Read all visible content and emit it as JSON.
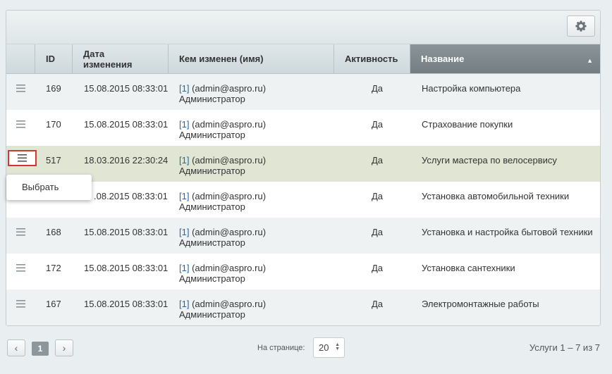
{
  "header": {
    "col_id": "ID",
    "col_date_1": "Дата",
    "col_date_2": "изменения",
    "col_modified": "Кем изменен (имя)",
    "col_active": "Активность",
    "col_name": "Название",
    "sort_arrow": "▲"
  },
  "rows": [
    {
      "id": "169",
      "date": "15.08.2015 08:33:01",
      "user_link": "[1]",
      "user_email": " (admin@aspro.ru)",
      "user_role": "Администратор",
      "active": "Да",
      "name": "Настройка компьютера"
    },
    {
      "id": "170",
      "date": "15.08.2015 08:33:01",
      "user_link": "[1]",
      "user_email": " (admin@aspro.ru)",
      "user_role": "Администратор",
      "active": "Да",
      "name": "Страхование покупки"
    },
    {
      "id": "517",
      "date": "18.03.2016 22:30:24",
      "user_link": "[1]",
      "user_email": " (admin@aspro.ru)",
      "user_role": "Администратор",
      "active": "Да",
      "name": "Услуги мастера по велосервису"
    },
    {
      "id": "",
      "date": ".08.2015 08:33:01",
      "user_link": "[1]",
      "user_email": " (admin@aspro.ru)",
      "user_role": "Администратор",
      "active": "Да",
      "name": "Установка автомобильной техники"
    },
    {
      "id": "168",
      "date": "15.08.2015 08:33:01",
      "user_link": "[1]",
      "user_email": " (admin@aspro.ru)",
      "user_role": "Администратор",
      "active": "Да",
      "name": "Установка и настройка бытовой техники"
    },
    {
      "id": "172",
      "date": "15.08.2015 08:33:01",
      "user_link": "[1]",
      "user_email": " (admin@aspro.ru)",
      "user_role": "Администратор",
      "active": "Да",
      "name": "Установка сантехники"
    },
    {
      "id": "167",
      "date": "15.08.2015 08:33:01",
      "user_link": "[1]",
      "user_email": " (admin@aspro.ru)",
      "user_role": "Администратор",
      "active": "Да",
      "name": "Электромонтажные работы"
    }
  ],
  "popup": {
    "select_label": "Выбрать"
  },
  "footer": {
    "prev": "‹",
    "page": "1",
    "next": "›",
    "per_page_label": "На странице:",
    "per_page_value": "20",
    "total": "Услуги 1 – 7 из 7"
  },
  "icons": {
    "settings": "gear-icon",
    "row_menu": "hamburger-icon"
  },
  "colors": {
    "link": "#2067b0",
    "selected_row": "#e0e6d3",
    "active_header": "#7d878c",
    "highlight_border": "#d0392f"
  }
}
